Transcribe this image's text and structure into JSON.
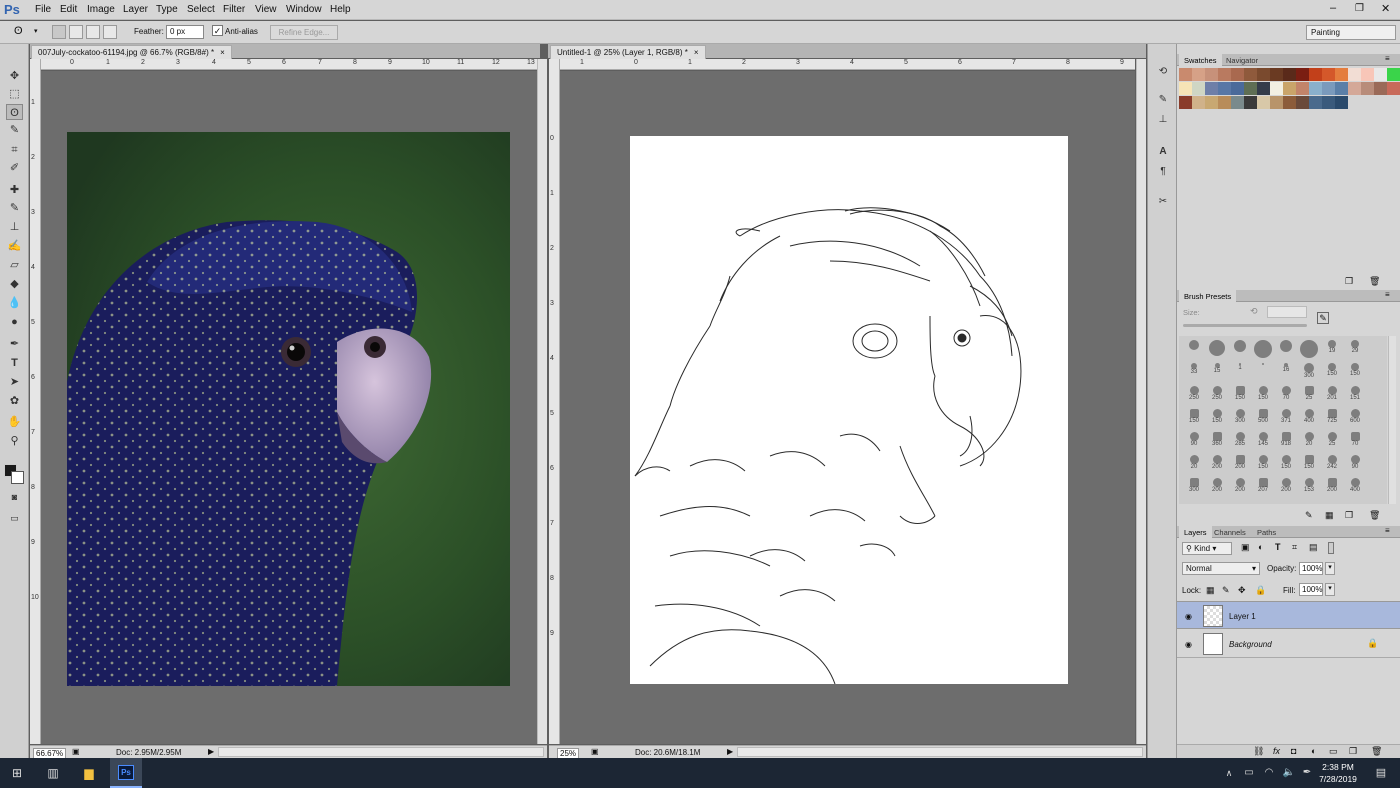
{
  "app": {
    "logo": "Ps"
  },
  "menu": [
    "File",
    "Edit",
    "Image",
    "Layer",
    "Type",
    "Select",
    "Filter",
    "View",
    "Window",
    "Help"
  ],
  "options": {
    "feather_label": "Feather:",
    "feather_value": "0 px",
    "antialias_label": "Anti-alias",
    "refine_edge": "Refine Edge...",
    "workspace": "Painting"
  },
  "doc1": {
    "tab": "007July-cockatoo-61194.jpg @ 66.7% (RGB/8#) *",
    "close": "×",
    "zoom": "66.67%",
    "info": "Doc: 2.95M/2.95M",
    "ruler_h": [
      "0",
      "1",
      "2",
      "3",
      "4",
      "5",
      "6",
      "7",
      "8",
      "9",
      "10",
      "11",
      "12",
      "13"
    ],
    "ruler_v": [
      "1",
      "2",
      "3",
      "4",
      "5",
      "6",
      "7",
      "8",
      "9",
      "10"
    ]
  },
  "doc2": {
    "tab": "Untitled-1 @ 25% (Layer 1, RGB/8) *",
    "close": "×",
    "zoom": "25%",
    "info": "Doc: 20.6M/18.1M",
    "ruler_h": [
      "1",
      "0",
      "1",
      "2",
      "3",
      "4",
      "5",
      "6",
      "7",
      "8",
      "9"
    ],
    "ruler_v": [
      "0",
      "1",
      "2",
      "3",
      "4",
      "5",
      "6",
      "7",
      "8",
      "9"
    ]
  },
  "swatches": {
    "tabs": [
      "Swatches",
      "Navigator"
    ],
    "colors": [
      "#c98a6e",
      "#d6a187",
      "#c7917a",
      "#b97a60",
      "#a9694f",
      "#8f5a3c",
      "#7a4a2e",
      "#6a3a22",
      "#5a2a1a",
      "#7a1e12",
      "#c2401a",
      "#d4582a",
      "#e47d3e",
      "#f2ddd4",
      "#f8c6b8",
      "#e8e8e8",
      "#3ad44a",
      "#f6e4b6",
      "#cfd6c4",
      "#6e7fa8",
      "#5877a6",
      "#4a6a9a",
      "#5e6e54",
      "#343c4a",
      "#f2efe2",
      "#c9a46a",
      "#c2846a",
      "#8ab0cc",
      "#7a9abc",
      "#5a7fa8",
      "#d4a898",
      "#b88c7a",
      "#9a6a58",
      "#c86a5a",
      "#8a3c2a",
      "#d0b28a",
      "#c8a872",
      "#b88c5a",
      "#7a8a8c",
      "#3a3a3a",
      "#d8c8a8",
      "#b8946a",
      "#8c5c3a",
      "#6a4a3a",
      "#4a6a8c",
      "#3a5a7c",
      "#2a4a6c"
    ]
  },
  "brush_presets": {
    "title": "Brush Presets",
    "size_label": "Size:",
    "labels": [
      "",
      "",
      "",
      "",
      "",
      "",
      "19",
      "29",
      "33",
      "15",
      "1",
      "",
      "16",
      "300",
      "150",
      "150",
      "250",
      "250",
      "150",
      "150",
      "70",
      "25",
      "201",
      "151",
      "150",
      "150",
      "300",
      "500",
      "371",
      "400",
      "725",
      "600",
      "90",
      "360",
      "285",
      "145",
      "918",
      "20",
      "25",
      "70",
      "20",
      "200",
      "200",
      "150",
      "150",
      "150",
      "242",
      "90",
      "300",
      "200",
      "200",
      "207",
      "200",
      "153",
      "200",
      "400"
    ]
  },
  "layers": {
    "tabs": [
      "Layers",
      "Channels",
      "Paths"
    ],
    "kind": "Kind",
    "blend": "Normal",
    "opacity_label": "Opacity:",
    "opacity": "100%",
    "lock_label": "Lock:",
    "fill_label": "Fill:",
    "fill": "100%",
    "items": [
      {
        "name": "Layer 1"
      },
      {
        "name": "Background"
      }
    ]
  },
  "taskbar": {
    "time": "2:38 PM",
    "date": "7/28/2019"
  }
}
